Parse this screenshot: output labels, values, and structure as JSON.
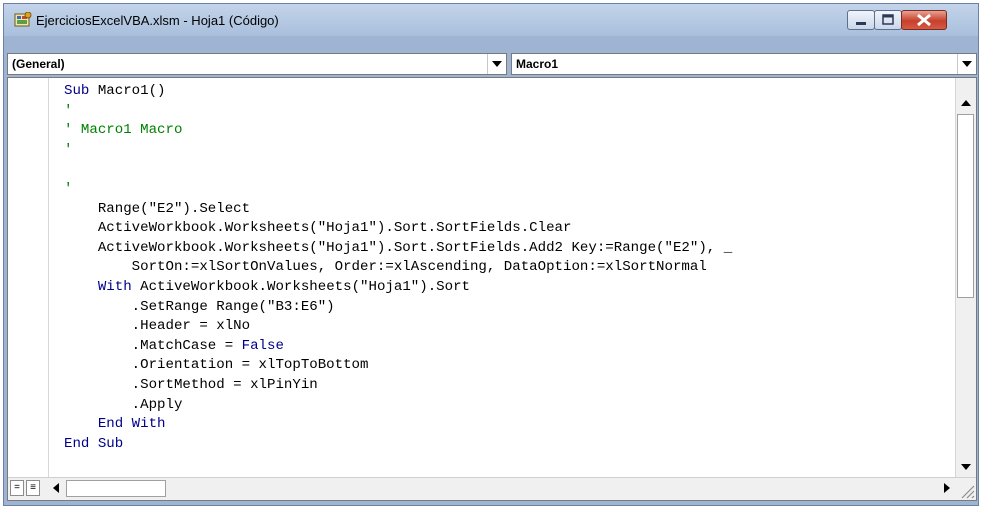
{
  "window": {
    "title": "EjerciciosExcelVBA.xlsm - Hoja1 (Código)",
    "icon": "vba-module-icon",
    "buttons": [
      "minimize-icon",
      "maximize-icon",
      "close-icon"
    ],
    "accent_close": "#c7402c"
  },
  "combos": {
    "object": "(General)",
    "procedure": "Macro1"
  },
  "code": {
    "lines": [
      {
        "text": "Sub Macro1()",
        "style": "mixed",
        "kw": "Sub",
        "rest": " Macro1()"
      },
      {
        "text": "'",
        "style": "comment"
      },
      {
        "text": "' Macro1 Macro",
        "style": "comment"
      },
      {
        "text": "'",
        "style": "comment"
      },
      {
        "text": "",
        "style": "plain"
      },
      {
        "text": "'",
        "style": "comment"
      },
      {
        "text": "    Range(\"E2\").Select",
        "style": "plain"
      },
      {
        "text": "    ActiveWorkbook.Worksheets(\"Hoja1\").Sort.SortFields.Clear",
        "style": "plain"
      },
      {
        "text": "    ActiveWorkbook.Worksheets(\"Hoja1\").Sort.SortFields.Add2 Key:=Range(\"E2\"), _",
        "style": "plain"
      },
      {
        "text": "        SortOn:=xlSortOnValues, Order:=xlAscending, DataOption:=xlSortNormal",
        "style": "plain"
      },
      {
        "text": "    With ActiveWorkbook.Worksheets(\"Hoja1\").Sort",
        "style": "with"
      },
      {
        "text": "        .SetRange Range(\"B3:E6\")",
        "style": "plain"
      },
      {
        "text": "        .Header = xlNo",
        "style": "plain"
      },
      {
        "text": "        .MatchCase = False",
        "style": "false"
      },
      {
        "text": "        .Orientation = xlTopToBottom",
        "style": "plain"
      },
      {
        "text": "        .SortMethod = xlPinYin",
        "style": "plain"
      },
      {
        "text": "        .Apply",
        "style": "plain"
      },
      {
        "text": "    End With",
        "style": "keyword"
      },
      {
        "text": "End Sub",
        "style": "keyword"
      }
    ],
    "colors": {
      "keyword": "#00008b",
      "comment": "#008000",
      "text": "#000000"
    }
  },
  "scrollbars": {
    "vertical": [
      "scroll-up-icon",
      "scroll-down-icon"
    ],
    "horizontal": [
      "scroll-left-icon",
      "scroll-right-icon"
    ]
  },
  "view_buttons": {
    "procedure_view_glyph": "=",
    "full_module_view_glyph": "≡"
  }
}
